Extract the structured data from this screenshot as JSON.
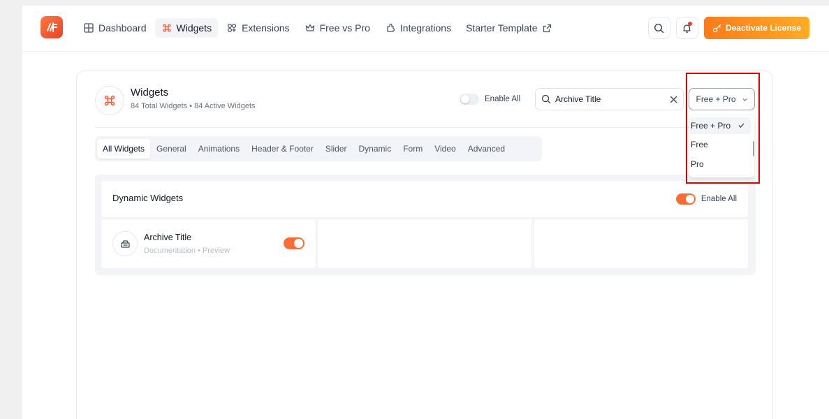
{
  "nav": {
    "items": [
      {
        "label": "Dashboard",
        "icon": "grid-icon",
        "active": false
      },
      {
        "label": "Widgets",
        "icon": "command-icon",
        "active": true
      },
      {
        "label": "Extensions",
        "icon": "puzzle-icon",
        "active": false
      },
      {
        "label": "Free vs Pro",
        "icon": "crown-icon",
        "active": false
      },
      {
        "label": "Integrations",
        "icon": "plug-icon",
        "active": false
      },
      {
        "label": "Starter Template",
        "icon": "external-link-icon",
        "active": false
      }
    ]
  },
  "header_actions": {
    "deactivate_label": "Deactivate License"
  },
  "widgets_panel": {
    "title": "Widgets",
    "subtitle": "84 Total Widgets • 84 Active Widgets",
    "enable_all_label": "Enable All",
    "search": {
      "value": "Archive Title",
      "placeholder": "Search..."
    },
    "filter": {
      "selected": "Free + Pro",
      "options": [
        "Free + Pro",
        "Free",
        "Pro"
      ]
    }
  },
  "tabs": [
    "All Widgets",
    "General",
    "Animations",
    "Header & Footer",
    "Slider",
    "Dynamic",
    "Form",
    "Video",
    "Advanced"
  ],
  "section": {
    "title": "Dynamic Widgets",
    "enable_all_label": "Enable All",
    "widgets": [
      {
        "name": "Archive Title",
        "links": "Documentation • Preview",
        "enabled": true
      }
    ]
  },
  "colors": {
    "accent": "#ff6b35",
    "brand_gradient_start": "#ff7a1a",
    "brand_gradient_end": "#ffac25",
    "highlight": "#e20000"
  }
}
